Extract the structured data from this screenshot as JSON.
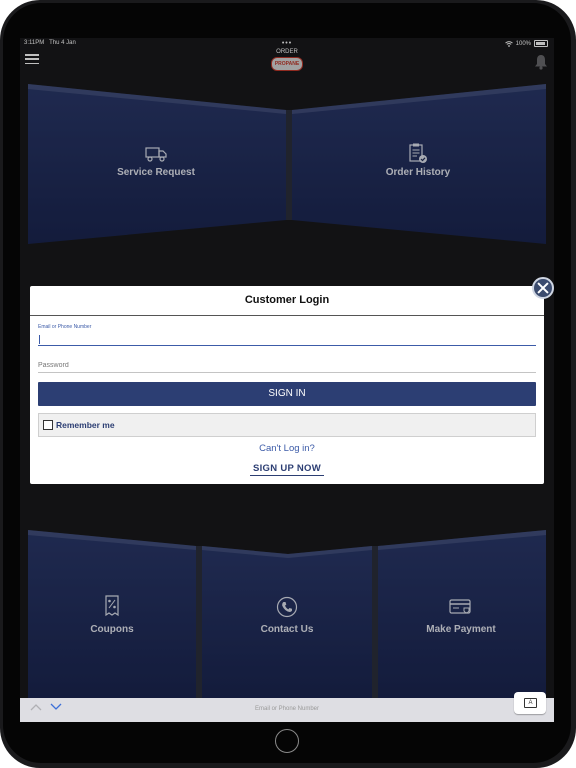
{
  "status": {
    "time": "3:11PM",
    "date": "Thu 4 Jan",
    "battery": "100%"
  },
  "header": {
    "menu_icon": "hamburger-icon",
    "logo_dots": "•••",
    "logo_top": "ORDER",
    "logo_badge": "PROPANE",
    "bell_icon": "bell-icon"
  },
  "tiles_top": [
    {
      "label": "Service Request",
      "icon": "truck-icon"
    },
    {
      "label": "Order History",
      "icon": "clipboard-check-icon"
    }
  ],
  "tiles_bottom": [
    {
      "label": "Coupons",
      "icon": "coupon-icon"
    },
    {
      "label": "Contact Us",
      "icon": "phone-icon"
    },
    {
      "label": "Make Payment",
      "icon": "card-icon"
    }
  ],
  "login": {
    "title": "Customer Login",
    "email_label": "Email or Phone Number",
    "email_value": "",
    "password_placeholder": "Password",
    "signin_label": "SIGN IN",
    "remember_label": "Remember me",
    "remember_checked": false,
    "cant_login": "Can't Log in?",
    "signup_label": "SIGN UP NOW"
  },
  "keyboard_bar": {
    "hint": "Email or Phone Number",
    "up_icon": "chevron-up-icon",
    "down_icon": "chevron-down-icon",
    "keyboard_icon": "keyboard-icon",
    "keyboard_key": "A"
  },
  "colors": {
    "tile_bg": "#1f2c55",
    "accent": "#2c3e73",
    "link": "#3c5ba8",
    "screen_bg": "#19191b"
  }
}
